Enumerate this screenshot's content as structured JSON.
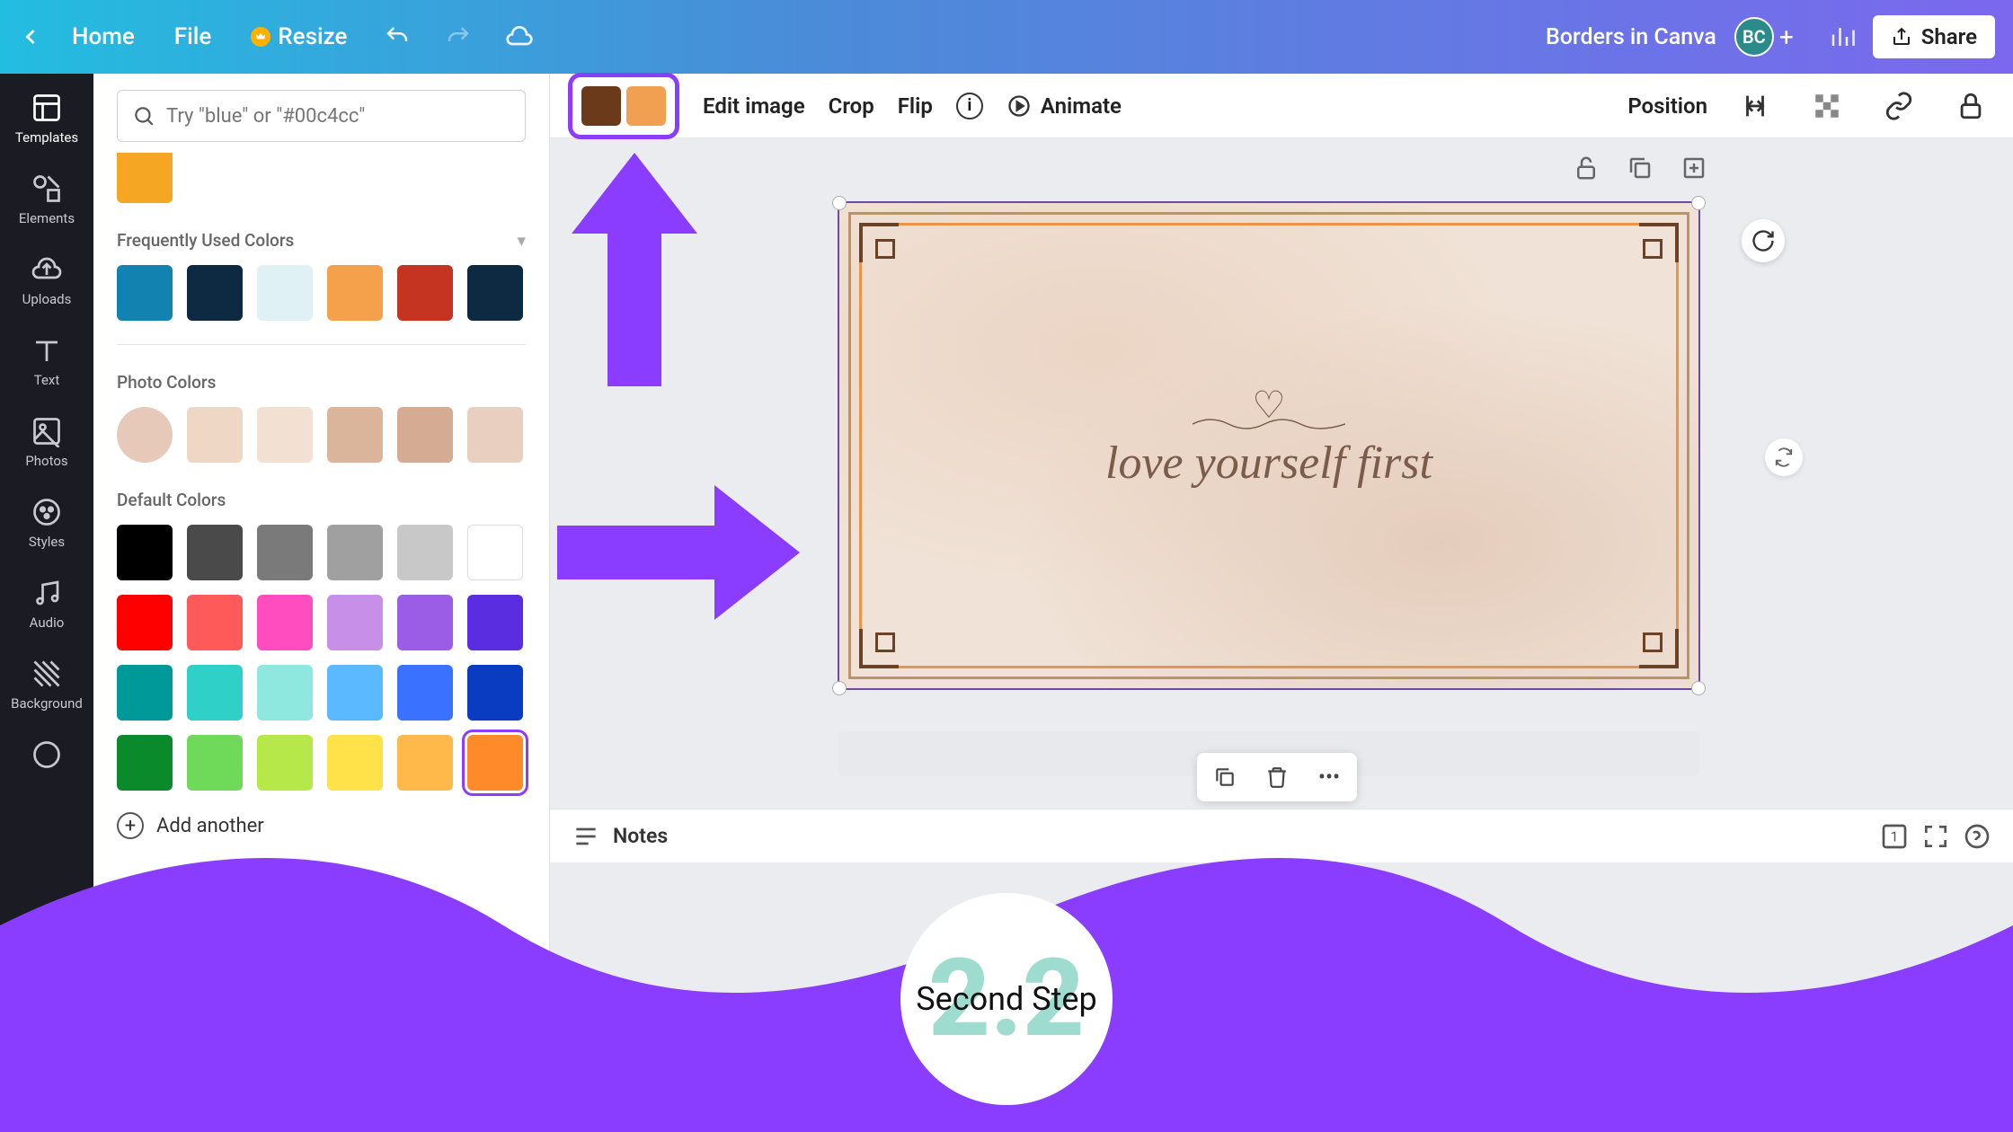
{
  "top": {
    "home": "Home",
    "file": "File",
    "resize": "Resize",
    "doc_title": "Borders in Canva",
    "avatar": "BC",
    "share": "Share"
  },
  "rail": {
    "templates": "Templates",
    "elements": "Elements",
    "uploads": "Uploads",
    "text": "Text",
    "photos": "Photos",
    "styles": "Styles",
    "audio": "Audio",
    "background": "Background"
  },
  "panel": {
    "search_placeholder": "Try \"blue\" or \"#00c4cc\"",
    "freq_label": "Frequently Used Colors",
    "freq_colors": [
      "#1282b0",
      "#0e2a42",
      "#dff1f5",
      "#f5a04a",
      "#c53321",
      "#0e2a42"
    ],
    "photo_label": "Photo Colors",
    "photo_colors": [
      "#e6c9b8",
      "#efd7c6",
      "#f2e0d3",
      "#dbb49c",
      "#d6ab93",
      "#e9cfbf"
    ],
    "default_label": "Default Colors",
    "default_colors": [
      [
        "#000000",
        "#4a4a4a",
        "#7a7a7a",
        "#a0a0a0",
        "#c8c8c8",
        "#ffffff"
      ],
      [
        "#ff0000",
        "#ff5a5a",
        "#ff4dbf",
        "#c78fe8",
        "#9b5de5",
        "#5a2ee0"
      ],
      [
        "#009999",
        "#2fd0c8",
        "#8fe8e0",
        "#5ab9ff",
        "#3a72ff",
        "#0a3cc2"
      ],
      [
        "#0a8a2a",
        "#6fd95a",
        "#b6e84a",
        "#ffe14a",
        "#ffb84a",
        "#ff8a2a"
      ]
    ],
    "selected_color": "#ff8a2a",
    "add_label": "Add another"
  },
  "ctx": {
    "chip1": "#6b3a1a",
    "chip2": "#f0a050",
    "edit_image": "Edit image",
    "crop": "Crop",
    "flip": "Flip",
    "animate": "Animate",
    "position": "Position"
  },
  "canvas": {
    "script": "love yourself first"
  },
  "bottom": {
    "notes": "Notes"
  },
  "footer": {
    "step_num": "2.2",
    "step_label": "Second Step"
  }
}
